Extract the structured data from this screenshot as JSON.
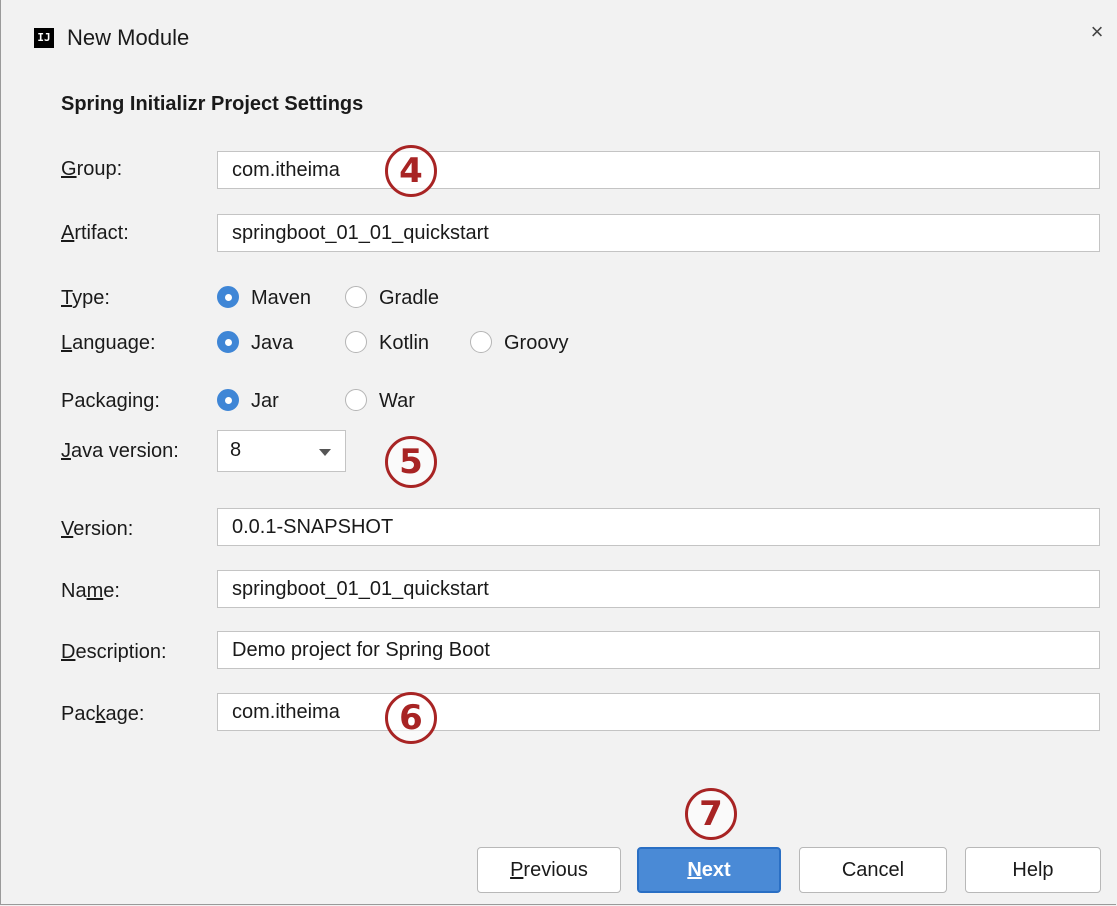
{
  "window": {
    "title": "New Module",
    "app_icon": "IJ",
    "close_glyph": "×"
  },
  "section_title": "Spring Initializr Project Settings",
  "fields": {
    "group": {
      "label_mn": "G",
      "label_rest": "roup:",
      "value": "com.itheima"
    },
    "artifact": {
      "label_mn": "A",
      "label_rest": "rtifact:",
      "value": "springboot_01_01_quickstart"
    },
    "version": {
      "label_mn": "V",
      "label_rest": "ersion:",
      "value": "0.0.1-SNAPSHOT"
    },
    "name": {
      "label_pre": "Na",
      "label_mn": "m",
      "label_rest": "e:",
      "value": "springboot_01_01_quickstart"
    },
    "description": {
      "label_mn": "D",
      "label_rest": "escription:",
      "value": "Demo project for Spring Boot"
    },
    "package": {
      "label_pre": "Pac",
      "label_mn": "k",
      "label_rest": "age:",
      "value": "com.itheima"
    }
  },
  "type": {
    "label_mn": "T",
    "label_rest": "ype:",
    "options": [
      "Maven",
      "Gradle"
    ],
    "selected": "Maven"
  },
  "language": {
    "label_mn": "L",
    "label_rest": "anguage:",
    "options": [
      "Java",
      "Kotlin",
      "Groovy"
    ],
    "selected": "Java"
  },
  "packaging": {
    "label_pre": "Packa",
    "label_mn": "g",
    "label_rest": "ing:",
    "options": [
      "Jar",
      "War"
    ],
    "selected": "Jar"
  },
  "java_version": {
    "label_mn": "J",
    "label_rest": "ava version:",
    "value": "8"
  },
  "markers": [
    "4",
    "5",
    "6",
    "7"
  ],
  "buttons": {
    "previous": {
      "mn": "P",
      "rest": "revious"
    },
    "next": {
      "mn": "N",
      "rest": "ext"
    },
    "cancel": "Cancel",
    "help": "Help"
  },
  "colors": {
    "accent": "#3f86d6",
    "marker": "#a82424",
    "primary_button": "#4a8ad6"
  }
}
